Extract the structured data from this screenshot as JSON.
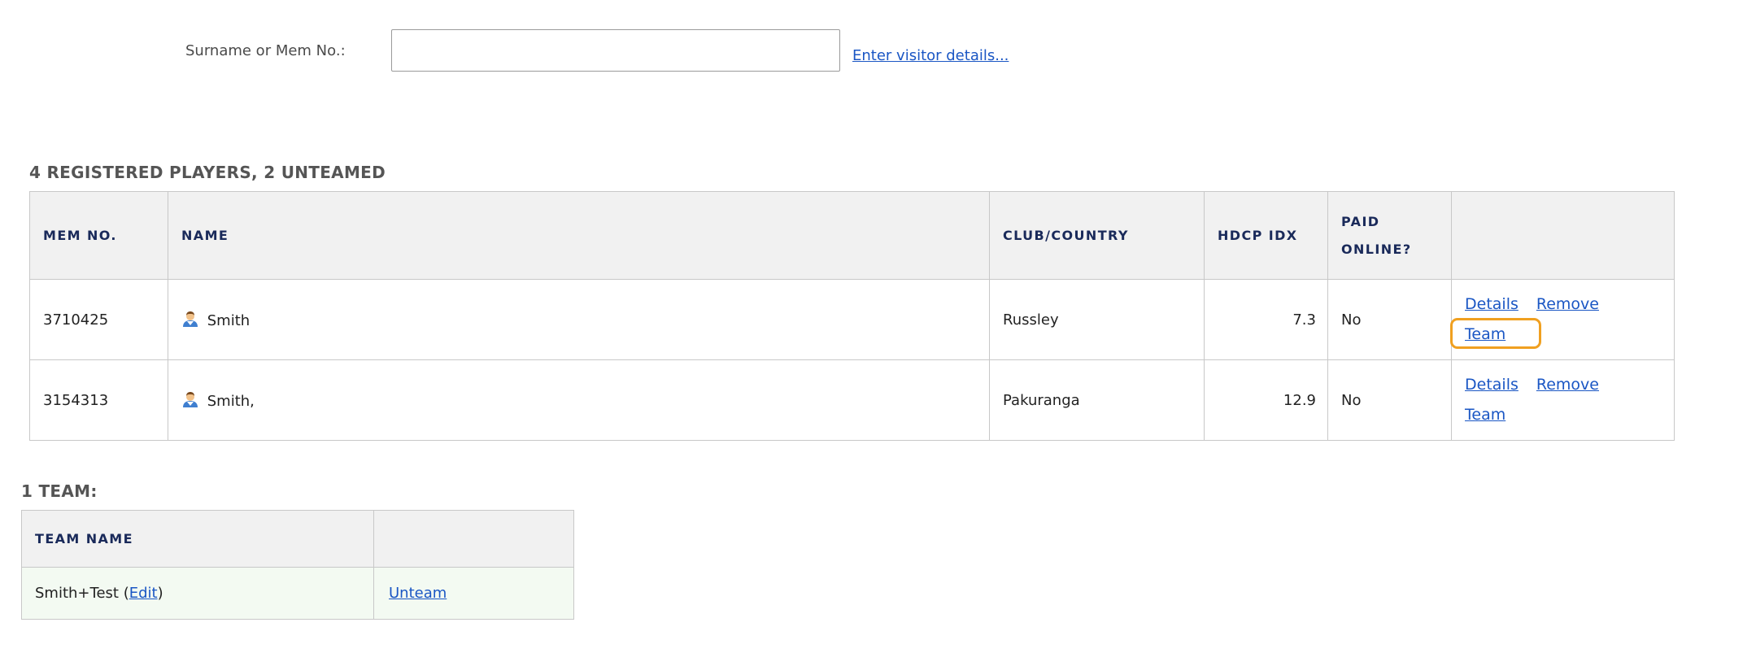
{
  "search": {
    "label": "Surname or Mem No.:",
    "value": "",
    "placeholder": "",
    "visitor_link": "Enter visitor details..."
  },
  "players": {
    "heading": "4 REGISTERED PLAYERS, 2 UNTEAMED",
    "columns": {
      "mem_no": "MEM NO.",
      "name": "NAME",
      "club": "CLUB/COUNTRY",
      "hdcp": "HDCP IDX",
      "paid": "PAID ONLINE?",
      "actions": ""
    },
    "rows": [
      {
        "mem_no": "3710425",
        "name": "Smith",
        "club": "Russley",
        "hdcp": "7.3",
        "paid": "No",
        "details": "Details",
        "remove": "Remove",
        "team": "Team"
      },
      {
        "mem_no": "3154313",
        "name": "Smith,",
        "club": "Pakuranga",
        "hdcp": "12.9",
        "paid": "No",
        "details": "Details",
        "remove": "Remove",
        "team": "Team"
      }
    ]
  },
  "teams": {
    "heading": "1 TEAM:",
    "columns": {
      "team_name": "TEAM NAME",
      "action": ""
    },
    "rows": [
      {
        "name": "Smith+Test",
        "edit_open": "(",
        "edit": "Edit",
        "edit_close": ")",
        "unteam": "Unteam"
      }
    ]
  },
  "colors": {
    "link": "#1a56c4",
    "header_text": "#1a2a5a",
    "highlight": "#f0a020",
    "team_row_bg": "#f3faf2"
  },
  "icons": {
    "player": "person-icon"
  }
}
